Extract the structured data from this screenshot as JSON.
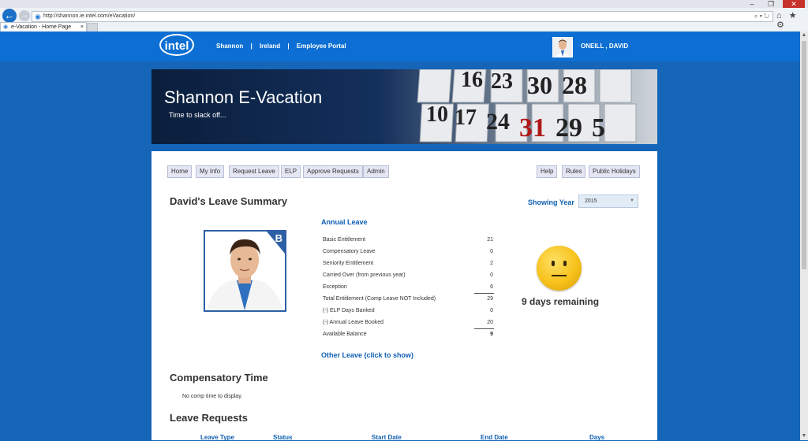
{
  "browser": {
    "url": "http://shannon.ie.intel.com/eVacation/",
    "tab_title": "e-Vacation - Home Page",
    "tab_close": "×",
    "back": "←",
    "forward": "→",
    "address_icons": "⌕ ▾ ↻",
    "toolbar_icons": "⌂ ★ ⚙",
    "window_minimize": "–",
    "window_restore": "❐",
    "window_close": "✕"
  },
  "header": {
    "logo": "intel",
    "nav": [
      "Shannon",
      "|",
      "Ireland",
      "|",
      "Employee Portal"
    ],
    "user_name": "ONEILL , DAVID"
  },
  "banner": {
    "title": "Shannon E-Vacation",
    "tagline": "Time to slack off...",
    "calendar_numbers": [
      "16",
      "23",
      "30",
      "28",
      "10",
      "17",
      "24",
      "31",
      "29",
      "5"
    ]
  },
  "menu_left": [
    "Home",
    "My Info",
    "Request Leave",
    "ELP",
    "Approve Requests",
    "Admin"
  ],
  "menu_right": [
    "Help",
    "Rules",
    "Public Holidays"
  ],
  "summary": {
    "heading": "David's Leave Summary",
    "showing_year_label": "Showing Year",
    "year": "2015",
    "photo_badge": "B",
    "annual_leave_heading": "Annual Leave",
    "rows": [
      {
        "label": "Basic Entitlement",
        "value": "21"
      },
      {
        "label": "Compensatory Leave",
        "value": "0"
      },
      {
        "label": "Seniority Entitlement",
        "value": "2"
      },
      {
        "label": "Carried Over (from previous year)",
        "value": "0"
      },
      {
        "label": "Exception",
        "value": "6"
      },
      {
        "label": "Total Entitlement (Comp Leave NOT Included)",
        "value": "29"
      },
      {
        "label": "(-) ELP Days Banked",
        "value": "0"
      },
      {
        "label": "(-) Annual Leave Booked",
        "value": "20"
      },
      {
        "label": "Available Balance",
        "value": "9"
      }
    ],
    "days_remaining": "9 days remaining",
    "other_leave_link": "Other Leave (click to show)"
  },
  "comp_time": {
    "heading": "Compensatory Time",
    "text": "No comp time to display."
  },
  "leave_requests": {
    "heading": "Leave Requests",
    "columns": [
      "Leave Type",
      "Status",
      "Start Date",
      "End Date",
      "Days"
    ]
  },
  "scrollbar": {
    "up": "▲",
    "down": "▼"
  },
  "colors": {
    "header_blue": "#0d6fd3",
    "page_blue": "#1565b8",
    "link_blue": "#0e5fb3",
    "smiley_yellow": "#f7c21a"
  },
  "icons": {
    "back": "back-arrow-icon",
    "forward": "forward-arrow-icon",
    "refresh": "refresh-icon",
    "home": "home-icon",
    "favorites": "star-icon",
    "settings": "gear-icon",
    "smiley": "neutral-face-icon"
  }
}
